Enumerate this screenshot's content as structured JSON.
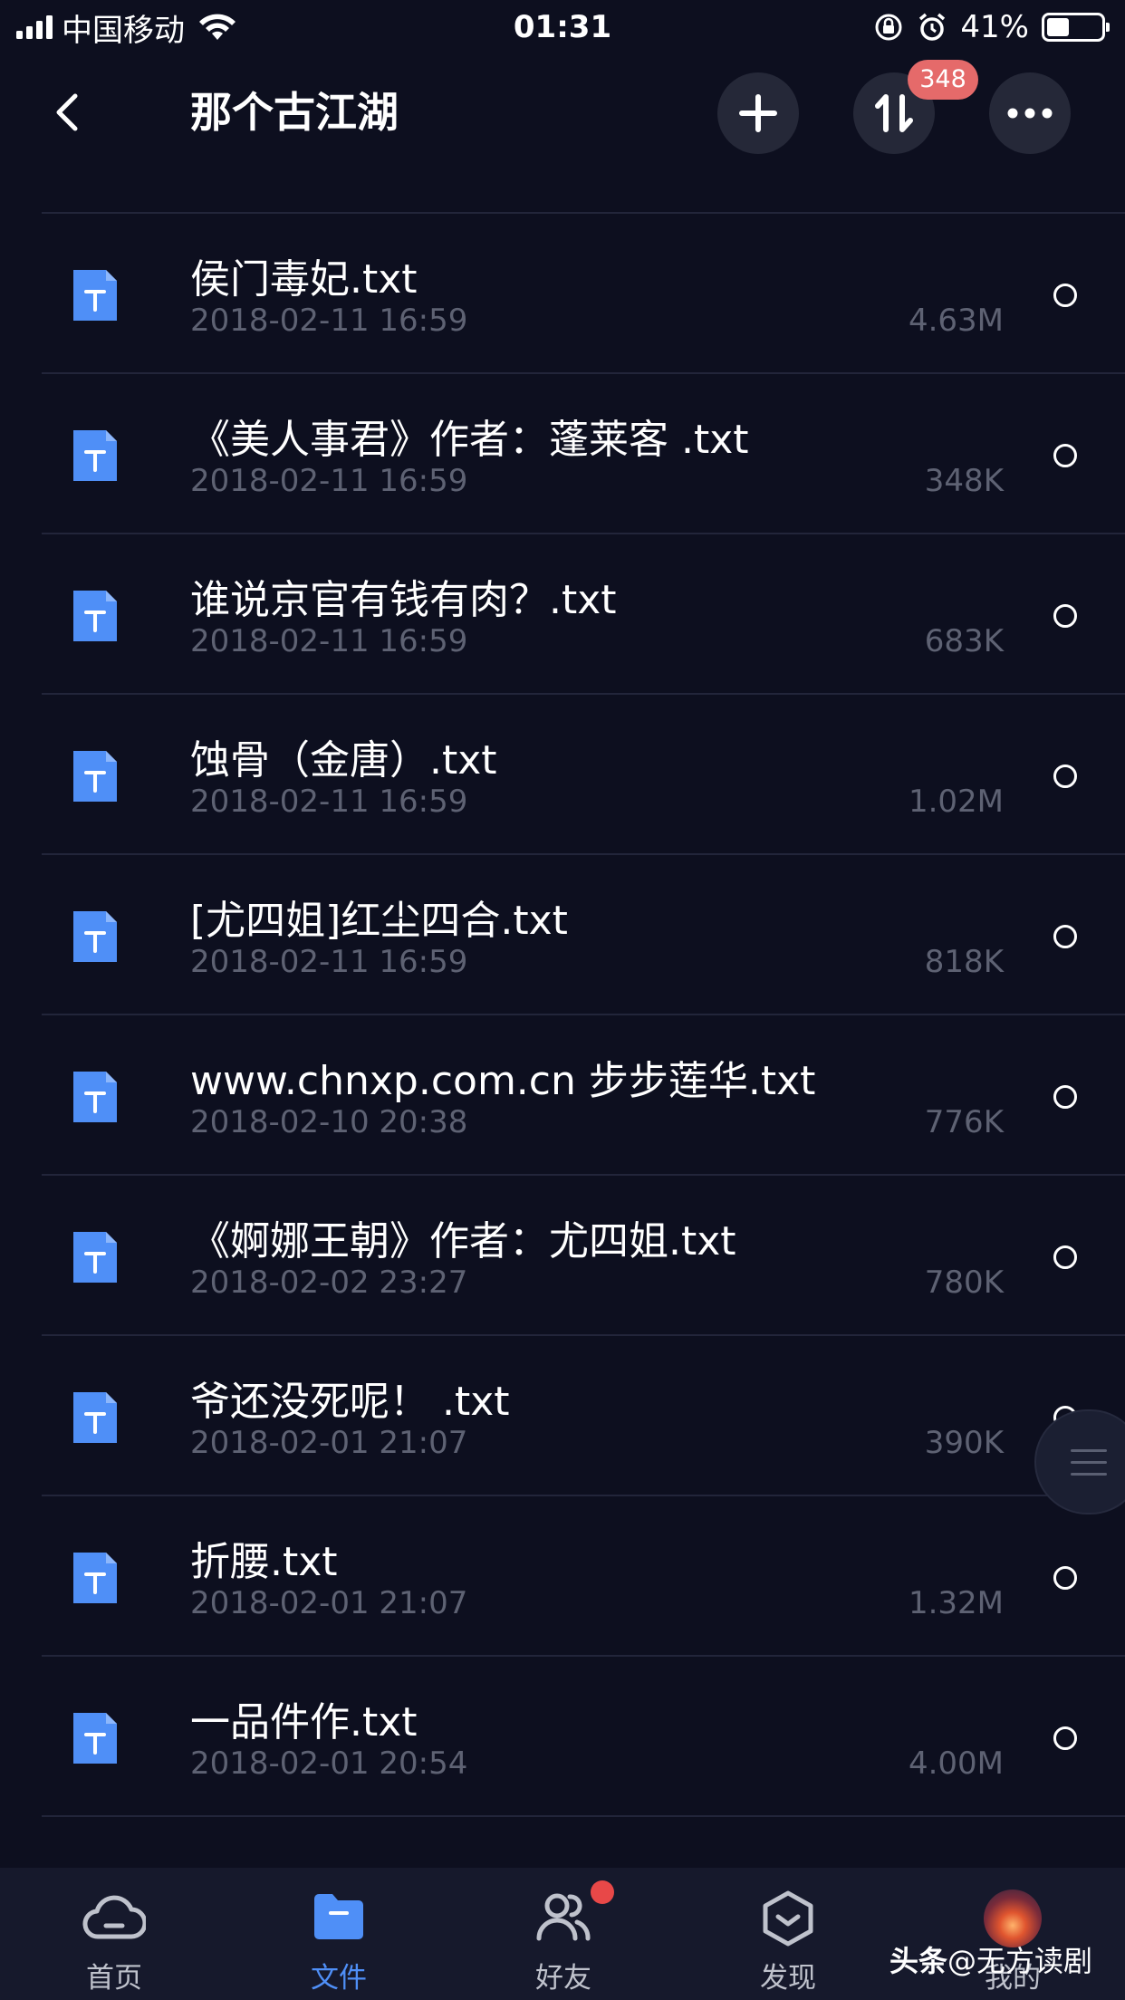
{
  "status_bar": {
    "carrier": "中国移动",
    "time": "01:31",
    "battery_percent": "41%",
    "battery_level": 0.41
  },
  "nav": {
    "title": "那个古江湖",
    "badge_count": "348"
  },
  "files": [
    {
      "name": "侯门毒妃.txt",
      "date": "2018-02-11 16:59",
      "size": "4.63M"
    },
    {
      "name": "《美人事君》作者：蓬莱客 .txt",
      "date": "2018-02-11 16:59",
      "size": "348K"
    },
    {
      "name": "谁说京官有钱有肉？.txt",
      "date": "2018-02-11 16:59",
      "size": "683K"
    },
    {
      "name": "蚀骨（金唐）.txt",
      "date": "2018-02-11 16:59",
      "size": "1.02M"
    },
    {
      "name": "[尤四姐]红尘四合.txt",
      "date": "2018-02-11 16:59",
      "size": "818K"
    },
    {
      "name": "www.chnxp.com.cn 步步莲华.txt",
      "date": "2018-02-10 20:38",
      "size": "776K"
    },
    {
      "name": "《婀娜王朝》作者：尤四姐.txt",
      "date": "2018-02-02 23:27",
      "size": "780K"
    },
    {
      "name": "爷还没死呢！ .txt",
      "date": "2018-02-01 21:07",
      "size": "390K"
    },
    {
      "name": "折腰.txt",
      "date": "2018-02-01 21:07",
      "size": "1.32M"
    },
    {
      "name": "一品件作.txt",
      "date": "2018-02-01 20:54",
      "size": "4.00M"
    }
  ],
  "tabs": {
    "home": "首页",
    "files": "文件",
    "friends": "好友",
    "discover": "发现",
    "mine": "我的"
  },
  "watermark": {
    "brand": "头条",
    "handle": "@无方读剧"
  },
  "colors": {
    "background": "#0d0f1f",
    "accent": "#4f8ff7",
    "badge": "#e56a6a",
    "secondary_text": "#5e6273"
  }
}
